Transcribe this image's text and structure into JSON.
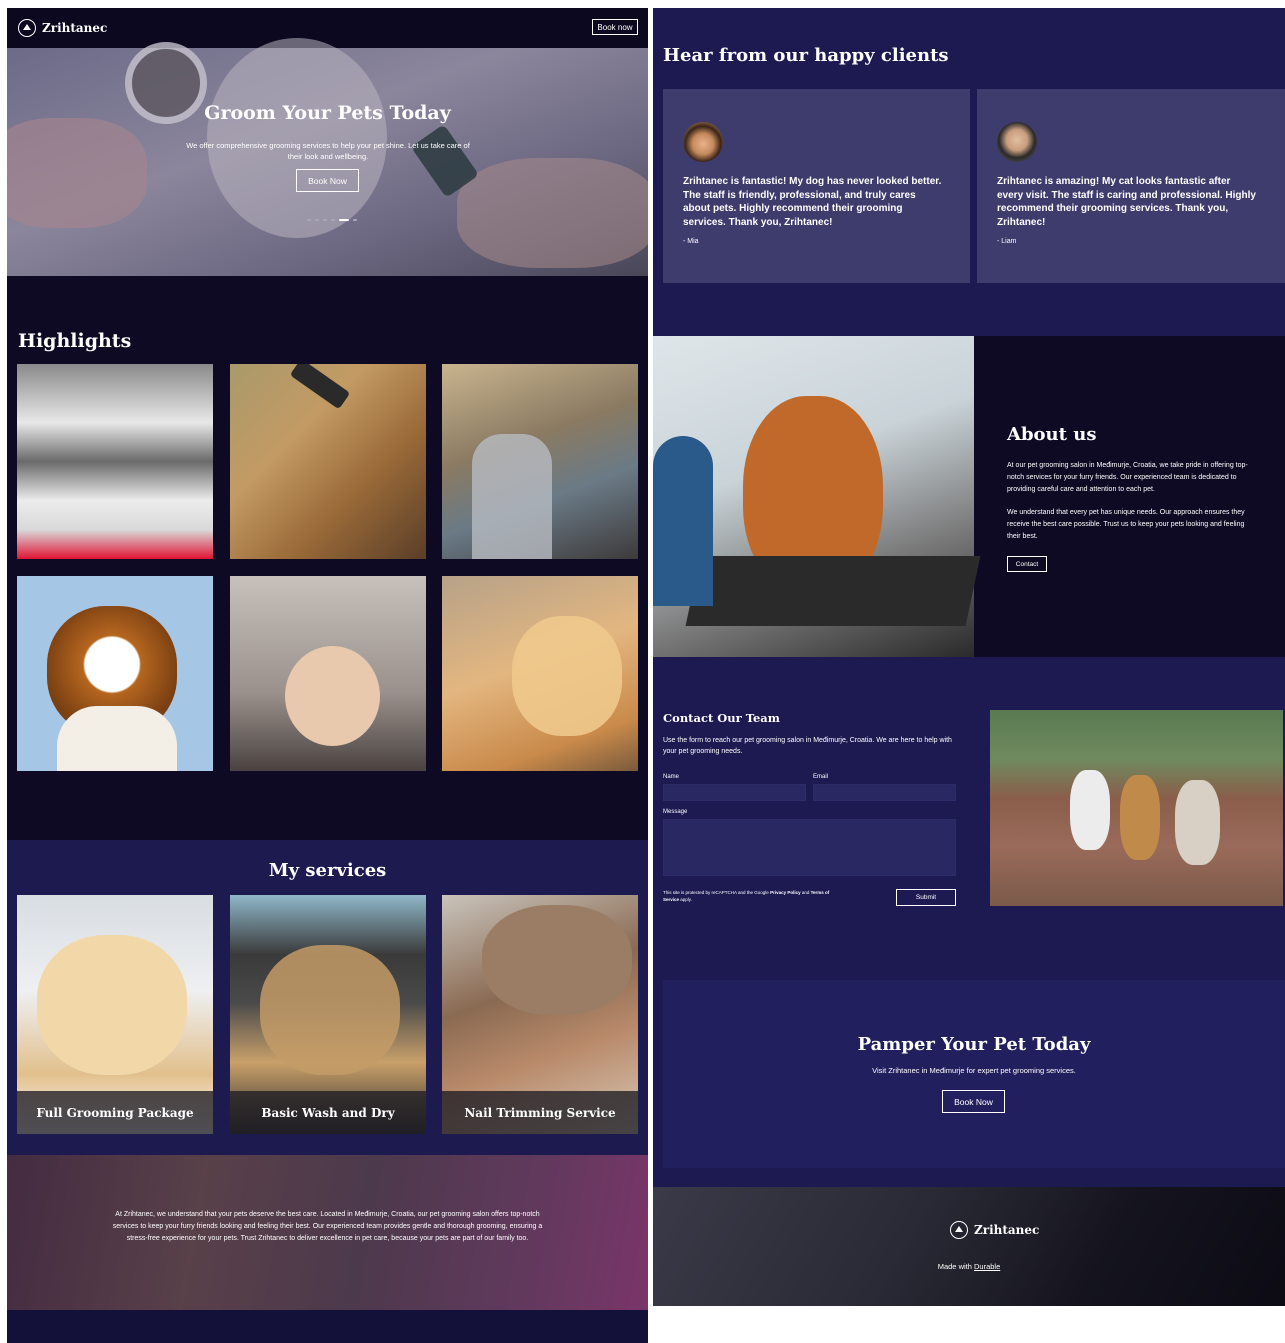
{
  "header": {
    "logo_text": "Zrihtanec",
    "book_button": "Book now"
  },
  "hero": {
    "title": "Groom Your Pets Today",
    "subtitle": "We offer comprehensive grooming services to help your pet shine. Let us take care of their look and wellbeing.",
    "button": "Book Now",
    "slides": 6,
    "active_slide": 5
  },
  "highlights": {
    "title": "Highlights"
  },
  "services": {
    "title": "My services",
    "items": [
      {
        "label": "Full Grooming Package"
      },
      {
        "label": "Basic Wash and Dry"
      },
      {
        "label": "Nail Trimming Service"
      }
    ]
  },
  "banner": {
    "text": "At Zrihtanec, we understand that your pets deserve the best care. Located in Međimurje, Croatia, our pet grooming salon offers top-notch services to keep your furry friends looking and feeling their best. Our experienced team provides gentle and thorough grooming, ensuring a stress-free experience for your pets. Trust Zrihtanec to deliver excellence in pet care, because your pets are part of our family too."
  },
  "testimonials": {
    "title": "Hear from our happy clients",
    "items": [
      {
        "quote": "Zrihtanec is fantastic! My dog has never looked better. The staff is friendly, professional, and truly cares about pets. Highly recommend their grooming services. Thank you, Zrihtanec!",
        "author": "- Mia"
      },
      {
        "quote": "Zrihtanec is amazing! My cat looks fantastic after every visit. The staff is caring and professional. Highly recommend their grooming services. Thank you, Zrihtanec!",
        "author": "- Liam"
      }
    ]
  },
  "about": {
    "title": "About us",
    "p1": "At our pet grooming salon in Međimurje, Croatia, we take pride in offering top-notch services for your furry friends. Our experienced team is dedicated to providing careful care and attention to each pet.",
    "p2": "We understand that every pet has unique needs. Our approach ensures they receive the best care possible. Trust us to keep your pets looking and feeling their best.",
    "button": "Contact"
  },
  "contact": {
    "title": "Contact Our Team",
    "intro": "Use the form to reach our pet grooming salon in Međimurje, Croatia. We are here to help with your pet grooming needs.",
    "name_label": "Name",
    "email_label": "Email",
    "message_label": "Message",
    "recaptcha_prefix": "This site is protected by reCAPTCHA and the Google ",
    "privacy_link": "Privacy Policy",
    "recaptcha_and": " and ",
    "terms_link": "Terms of Service",
    "recaptcha_suffix": " apply.",
    "submit": "Submit"
  },
  "cta": {
    "title": "Pamper Your Pet Today",
    "text": "Visit Zrihtanec in Međimurje for expert pet grooming services.",
    "button": "Book Now"
  },
  "footer": {
    "logo_text": "Zrihtanec",
    "made_with_prefix": "Made with ",
    "made_with_link": "Durable"
  }
}
